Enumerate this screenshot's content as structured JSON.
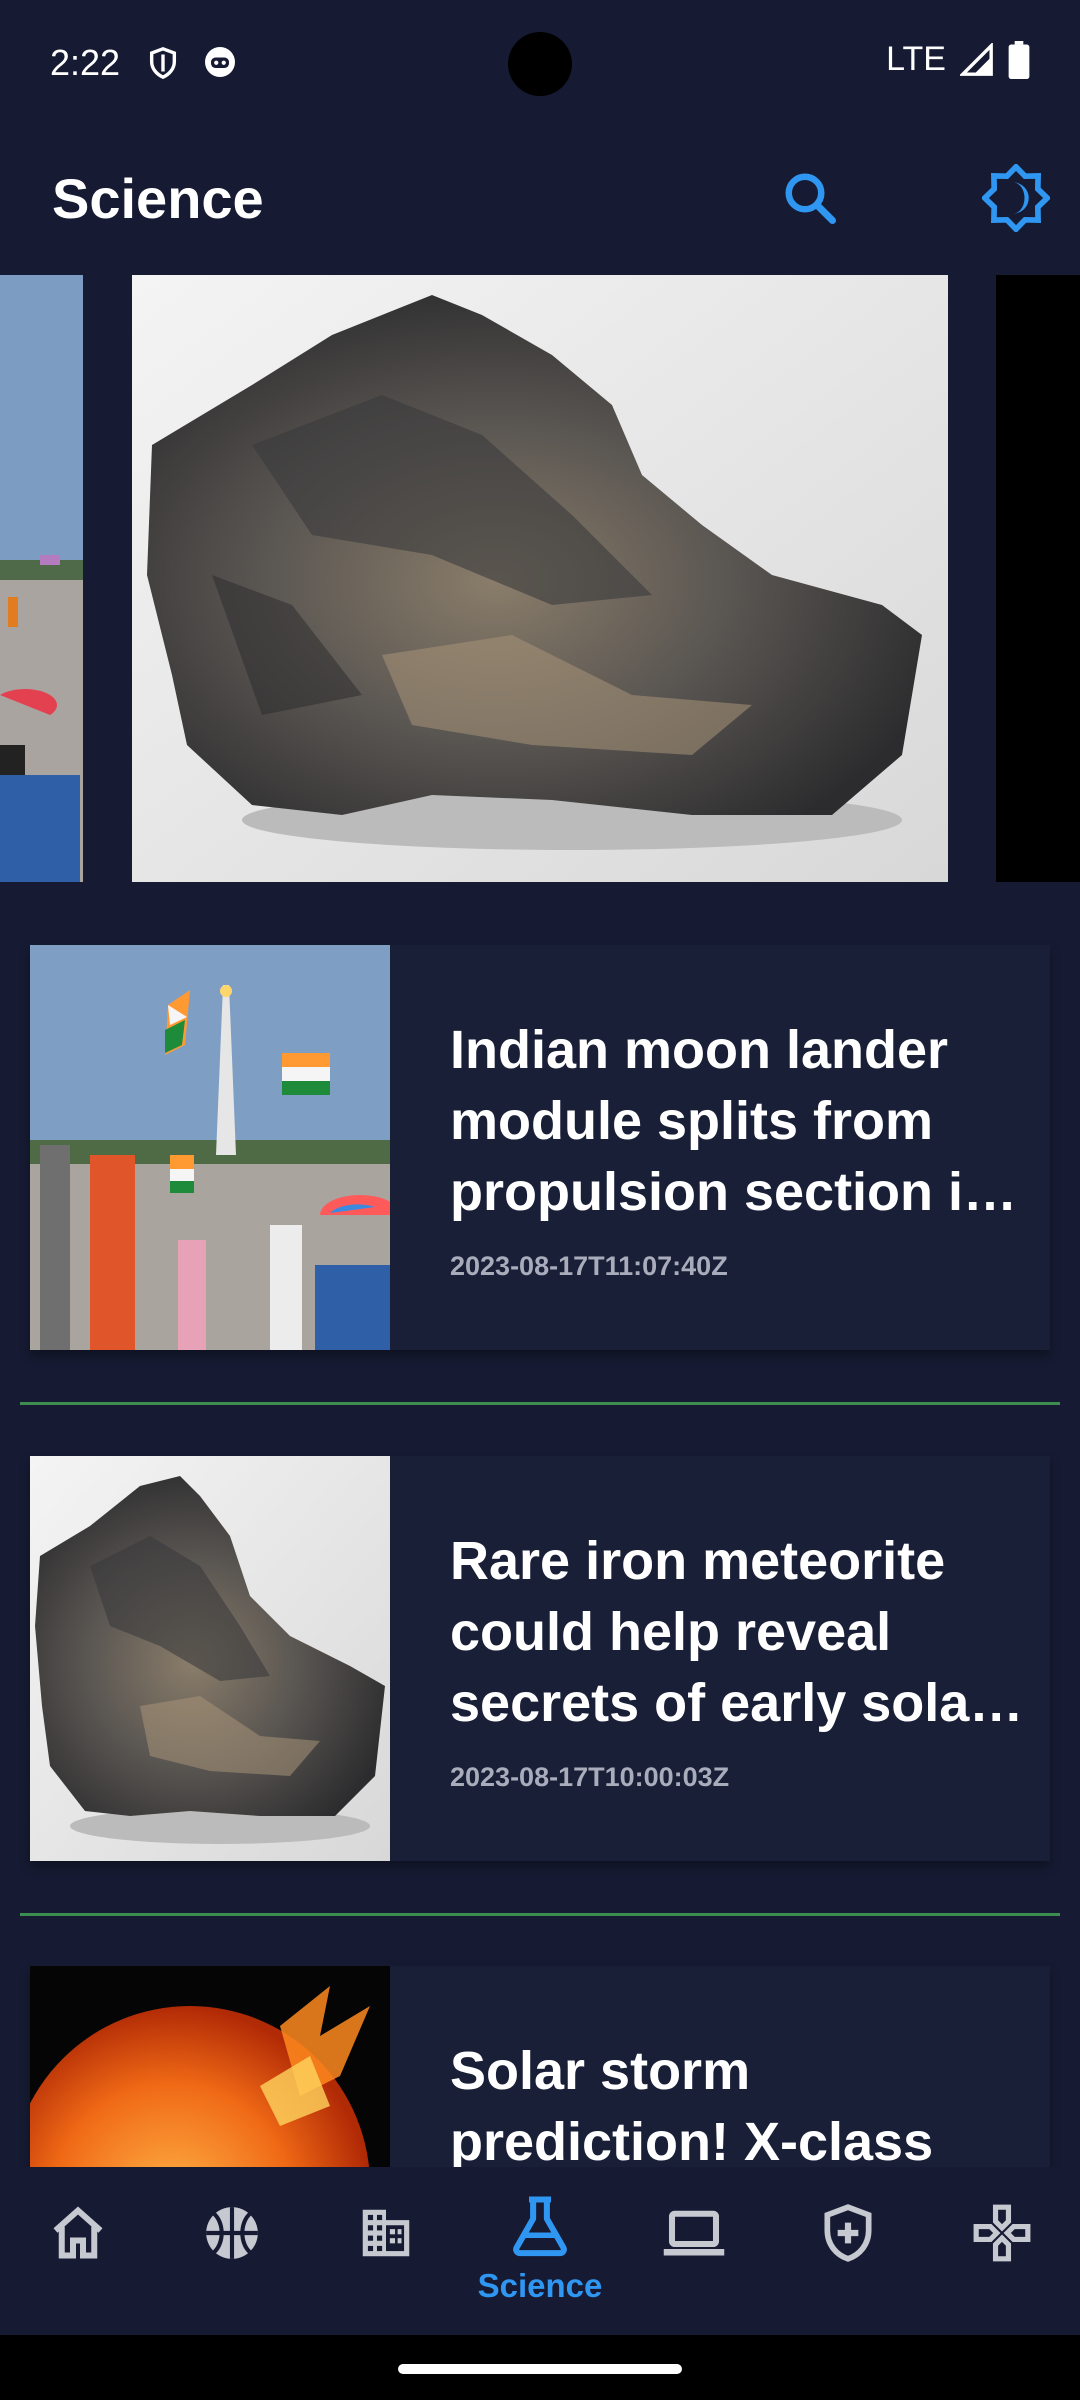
{
  "status": {
    "time": "2:22",
    "network": "LTE"
  },
  "app": {
    "title": "Science"
  },
  "icons": {
    "search": "search-icon",
    "theme": "brightness-icon",
    "accent": "#2f96f2",
    "inactive": "#c7c9d1"
  },
  "carousel": {
    "slides": [
      {
        "name": "launch-crowd-image"
      },
      {
        "name": "meteorite-image"
      },
      {
        "name": "black-image"
      }
    ]
  },
  "articles": [
    {
      "title": "Indian moon lander module splits from propulsion section i…",
      "date": "2023-08-17T11:07:40Z"
    },
    {
      "title": "Rare iron meteorite could help reveal secrets of early sola…",
      "date": "2023-08-17T10:00:03Z"
    },
    {
      "title": "Solar storm prediction! X-class",
      "date": ""
    }
  ],
  "nav": {
    "items": [
      {
        "icon": "home-icon",
        "label": ""
      },
      {
        "icon": "sports-basketball-icon",
        "label": ""
      },
      {
        "icon": "business-building-icon",
        "label": ""
      },
      {
        "icon": "science-flask-icon",
        "label": "Science"
      },
      {
        "icon": "laptop-icon",
        "label": ""
      },
      {
        "icon": "health-shield-icon",
        "label": ""
      },
      {
        "icon": "gamepad-icon",
        "label": ""
      }
    ]
  }
}
